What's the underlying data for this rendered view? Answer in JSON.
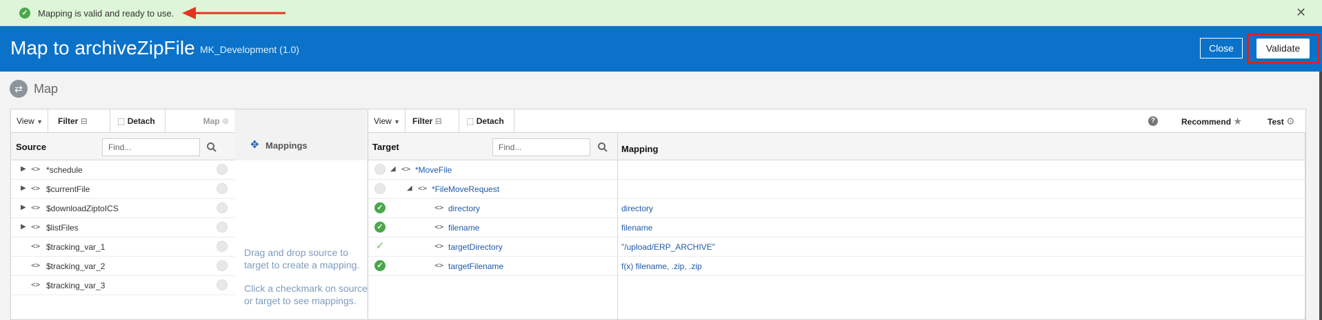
{
  "notification": {
    "message": "Mapping is valid and ready to use.",
    "close": "✕"
  },
  "header": {
    "title": "Map to archiveZipFile",
    "subtitle": "MK_Development (1.0)",
    "close_label": "Close",
    "validate_label": "Validate"
  },
  "section": {
    "label": "Map"
  },
  "source_panel": {
    "toolbar": {
      "view": "View",
      "filter": "Filter",
      "detach": "Detach",
      "map": "Map"
    },
    "header_label": "Source",
    "find_placeholder": "Find...",
    "rows": [
      {
        "name": "*schedule",
        "expandable": true
      },
      {
        "name": "$currentFile",
        "expandable": true
      },
      {
        "name": "$downloadZiptoICS",
        "expandable": true
      },
      {
        "name": "$listFiles",
        "expandable": true
      },
      {
        "name": "$tracking_var_1",
        "expandable": false
      },
      {
        "name": "$tracking_var_2",
        "expandable": false
      },
      {
        "name": "$tracking_var_3",
        "expandable": false
      }
    ]
  },
  "mappings_panel": {
    "title": "Mappings",
    "hint1": "Drag and drop source to target to create a mapping.",
    "hint2": "Click a checkmark on source or target to see mappings."
  },
  "target_panel": {
    "toolbar": {
      "view": "View",
      "filter": "Filter",
      "detach": "Detach",
      "recommend": "Recommend",
      "test": "Test"
    },
    "target_label": "Target",
    "mapping_label": "Mapping",
    "find_placeholder": "Find...",
    "rows": [
      {
        "name": "*MoveFile",
        "mapping": "",
        "status": "none"
      },
      {
        "name": "*FileMoveRequest",
        "mapping": "",
        "status": "none"
      },
      {
        "name": "directory",
        "mapping": "directory",
        "status": "mapped"
      },
      {
        "name": "filename",
        "mapping": "filename",
        "status": "mapped"
      },
      {
        "name": "targetDirectory",
        "mapping": "\"/upload/ERP_ARCHIVE\"",
        "status": "light"
      },
      {
        "name": "targetFilename",
        "mapping": "f(x) filename, .zip, .zip",
        "status": "mapped"
      }
    ]
  },
  "colors": {
    "header_bg": "#0a72c9",
    "notif_bg": "#dff5d8",
    "success": "#4aa84a",
    "highlight": "#e0201c",
    "link": "#1f5aa8"
  }
}
